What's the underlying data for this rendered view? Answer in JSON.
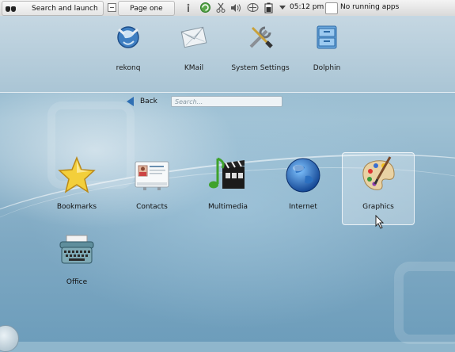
{
  "topbar": {
    "search_launch_label": "Search and launch",
    "page_label": "Page one",
    "clock": "05:12 pm",
    "tasks_label": "No running apps",
    "tray_icons": [
      "info-icon",
      "update-icon",
      "scissors-icon",
      "volume-icon",
      "network-icon",
      "battery-icon",
      "tray-expand-icon"
    ]
  },
  "favorites": [
    {
      "label": "rekonq",
      "icon": "rekonq-globe-icon"
    },
    {
      "label": "KMail",
      "icon": "kmail-envelope-icon"
    },
    {
      "label": "System Settings",
      "icon": "system-settings-tools-icon"
    },
    {
      "label": "Dolphin",
      "icon": "dolphin-cabinet-icon"
    }
  ],
  "nav": {
    "back_label": "Back",
    "search_placeholder": "Search..."
  },
  "categories": [
    {
      "label": "Bookmarks",
      "icon": "star-icon"
    },
    {
      "label": "Contacts",
      "icon": "contact-card-icon"
    },
    {
      "label": "Multimedia",
      "icon": "music-clapperboard-icon"
    },
    {
      "label": "Internet",
      "icon": "globe-icon"
    },
    {
      "label": "Graphics",
      "icon": "palette-icon",
      "selected": true
    },
    {
      "label": "Office",
      "icon": "typewriter-icon"
    }
  ],
  "colors": {
    "background": "#8fb6cc",
    "favorites_strip": "#bcd1de",
    "accent_blue": "#2f6fb3"
  }
}
